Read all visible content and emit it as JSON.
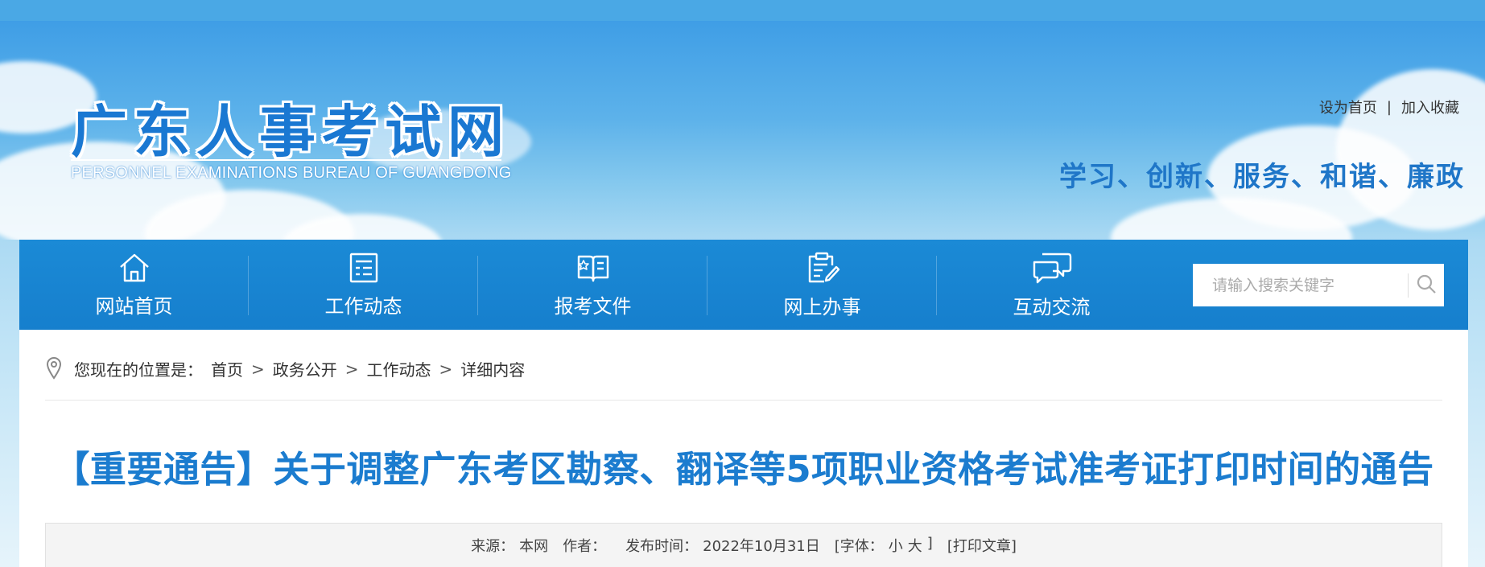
{
  "header": {
    "logo_cn": "广东人事考试网",
    "logo_en": "PERSONNEL EXAMINATIONS BUREAU OF GUANGDONG",
    "links": {
      "set_home": "设为首页",
      "separator": "|",
      "favorite": "加入收藏"
    },
    "slogan": "学习、创新、服务、和谐、廉政"
  },
  "nav": {
    "items": [
      {
        "label": "网站首页",
        "icon": "home-icon"
      },
      {
        "label": "工作动态",
        "icon": "news-list-icon"
      },
      {
        "label": "报考文件",
        "icon": "open-book-icon"
      },
      {
        "label": "网上办事",
        "icon": "clipboard-edit-icon"
      },
      {
        "label": "互动交流",
        "icon": "chat-bubbles-icon"
      }
    ],
    "search": {
      "placeholder": "请输入搜索关键字",
      "icon": "search-icon"
    }
  },
  "breadcrumb": {
    "prefix": "您现在的位置是：",
    "items": [
      "首页",
      "政务公开",
      "工作动态",
      "详细内容"
    ],
    "separator": ">"
  },
  "article": {
    "title": "【重要通告】关于调整广东考区勘察、翻译等5项职业资格考试准考证打印时间的通告",
    "meta": {
      "source_label": "来源：",
      "source": "本网",
      "author_label": "作者：",
      "author": "",
      "date_label": "发布时间：",
      "date": "2022年10月31日",
      "font_label": "[字体：",
      "font_small": "小",
      "font_large": "大",
      "font_close": "]",
      "print": "[打印文章]"
    }
  },
  "colors": {
    "accent": "#1b7ccf",
    "nav_bg": "#1b8ad6",
    "topbar": "#4aa8e5"
  }
}
